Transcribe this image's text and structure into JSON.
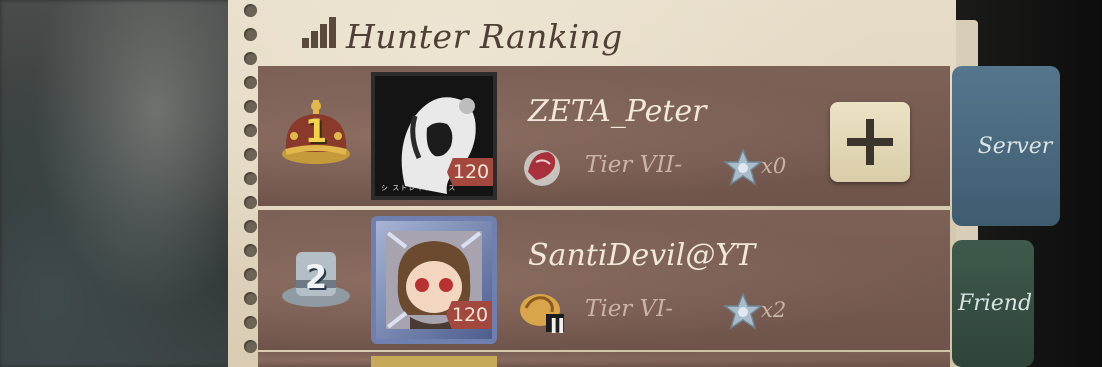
{
  "header": {
    "title": "Hunter Ranking",
    "icon": "ranking-bars-icon"
  },
  "rows": [
    {
      "rank": "1",
      "rank_icon": "gold-crown-icon",
      "name": "ZETA_Peter",
      "level": "120",
      "frame_caption": "シ ストレイドッグス",
      "tier": "Tier VII-",
      "tier_icon": "red-dragon-tier-icon",
      "stars": "x0",
      "has_add_button": true
    },
    {
      "rank": "2",
      "rank_icon": "silver-top-hat-icon",
      "name": "SantiDevil@YT",
      "level": "120",
      "tier": "Tier VI-",
      "tier_icon": "gold-beast-tier-icon",
      "tier_sub": "II",
      "stars": "x2"
    }
  ],
  "tabs": {
    "server": "Server",
    "friend": "Friend"
  },
  "colors": {
    "row_bg": "#7d6157",
    "paper": "#e6dcc8",
    "level_tag": "#a3483e",
    "server_tab": "#55768d",
    "friend_tab": "#3f5a4c"
  }
}
